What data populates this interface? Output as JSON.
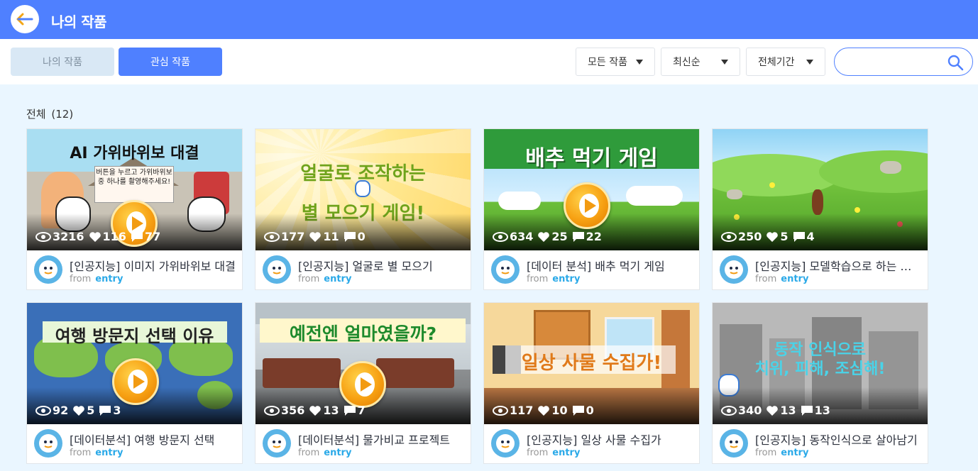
{
  "header": {
    "title": "나의 작품",
    "back_icon": "arrow-left-icon",
    "bg_color": "#4f80ff"
  },
  "tabs": [
    {
      "label": "나의 작품",
      "active": false
    },
    {
      "label": "관심 작품",
      "active": true
    }
  ],
  "filters": {
    "category": "모든 작품",
    "sort": "최신순",
    "period": "전체기간"
  },
  "search": {
    "value": "",
    "icon": "search-icon"
  },
  "summary": {
    "label": "전체",
    "count": "(12)"
  },
  "projects": [
    {
      "headline": "AI 가위바위보 대결",
      "headline2": "버튼을 누르고 가위바위보 중 하나를 촬영해주세요!",
      "views": "3216",
      "likes": "116",
      "comments": "77",
      "title": "[인공지능] 이미지 가위바위보 대결",
      "from": "from",
      "author": "entry",
      "thumb_color": "#a9def2"
    },
    {
      "headline": "얼굴로 조작하는",
      "headline2": "별 모으기 게임!",
      "views": "177",
      "likes": "11",
      "comments": "0",
      "title": "[인공지능] 얼굴로 별 모으기",
      "from": "from",
      "author": "entry",
      "thumb_color": "#ffe79a"
    },
    {
      "headline": "배추 먹기 게임",
      "headline2": "",
      "views": "634",
      "likes": "25",
      "comments": "22",
      "title": "[데이터 분석] 배추 먹기 게임",
      "from": "from",
      "author": "entry",
      "thumb_color": "#bde6fa"
    },
    {
      "headline": "",
      "headline2": "",
      "views": "250",
      "likes": "5",
      "comments": "4",
      "title": "[인공지능] 모델학습으로 하는 곤충 분류",
      "from": "from",
      "author": "entry",
      "thumb_color": "#6cc43a"
    },
    {
      "headline": "여행 방문지 선택 이유",
      "headline2": "",
      "views": "92",
      "likes": "5",
      "comments": "3",
      "title": "[데이터분석] 여행 방문지 선택",
      "from": "from",
      "author": "entry",
      "thumb_color": "#3a6fb8"
    },
    {
      "headline": "예전엔 얼마였을까?",
      "headline2": "",
      "views": "356",
      "likes": "13",
      "comments": "7",
      "title": "[데이터분석] 물가비교 프로젝트",
      "from": "from",
      "author": "entry",
      "thumb_color": "#cfd5d8"
    },
    {
      "headline": "일상 사물 수집가!",
      "headline2": "",
      "views": "117",
      "likes": "10",
      "comments": "0",
      "title": "[인공지능] 일상 사물 수집가",
      "from": "from",
      "author": "entry",
      "thumb_color": "#f6d89b"
    },
    {
      "headline": "동작 인식으로",
      "headline2": "치위, 피해, 조심해!",
      "views": "340",
      "likes": "13",
      "comments": "13",
      "title": "[인공지능] 동작인식으로 살아남기",
      "from": "from",
      "author": "entry",
      "thumb_color": "#9a9a9a"
    }
  ]
}
